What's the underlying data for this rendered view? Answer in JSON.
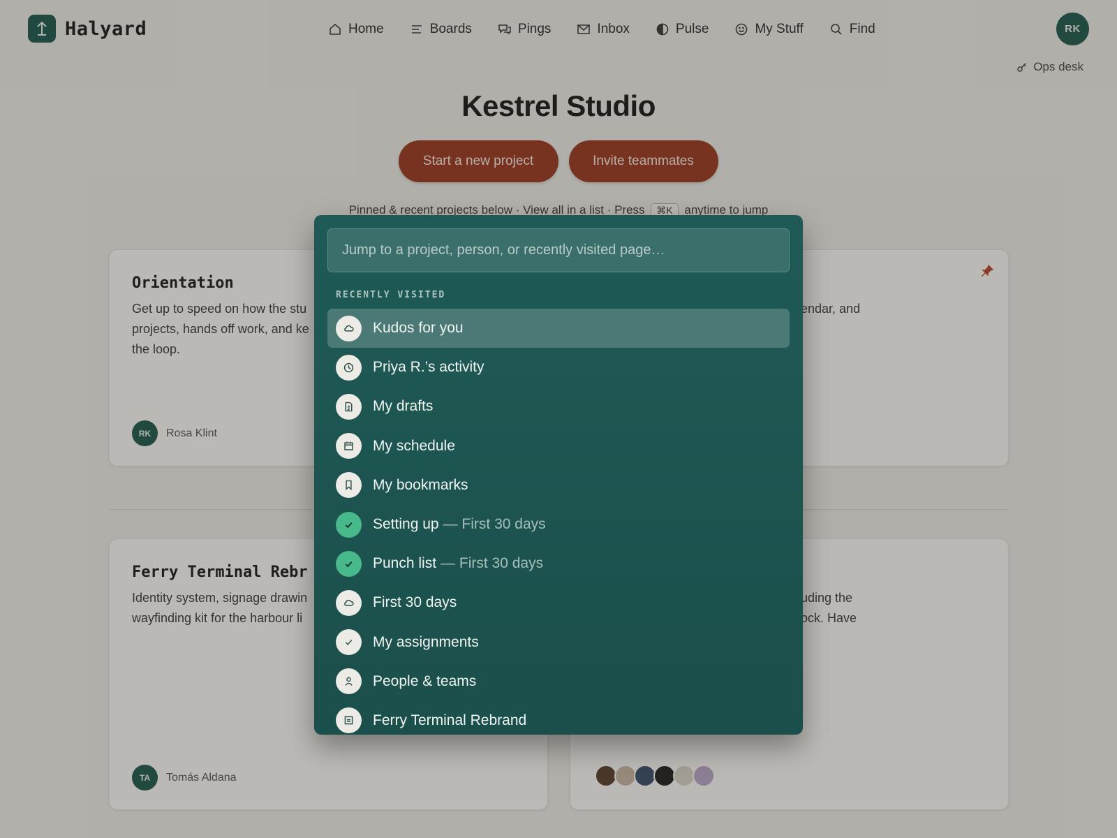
{
  "app": {
    "name": "Halyard"
  },
  "nav": [
    {
      "label": "Home",
      "icon": "home-icon"
    },
    {
      "label": "Boards",
      "icon": "boards-icon"
    },
    {
      "label": "Pings",
      "icon": "chat-icon"
    },
    {
      "label": "Inbox",
      "icon": "mail-icon"
    },
    {
      "label": "Pulse",
      "icon": "half-circle-icon"
    },
    {
      "label": "My Stuff",
      "icon": "smiley-icon"
    },
    {
      "label": "Find",
      "icon": "search-icon"
    }
  ],
  "user": {
    "initials": "RK"
  },
  "ops_desk": {
    "label": "Ops desk"
  },
  "page": {
    "title": "Kestrel Studio",
    "new_project_label": "Start a new project",
    "invite_label": "Invite teammates",
    "hint_pre": "Pinned & recent projects below · View all in a list · Press",
    "hint_key": "⌘K",
    "hint_post": "anytime to jump"
  },
  "cards": [
    {
      "title": "Orientation",
      "desc_lines": [
        "Get up to speed on how the stu",
        "projects, hands off work, and ke",
        "the loop."
      ],
      "owner_initials": "RK",
      "owner_name": "Rosa Klint"
    },
    {
      "desc_line": "endar, and"
    },
    {
      "title": "Ferry Terminal Rebr",
      "desc_lines": [
        "Identity system, signage drawin",
        "wayfinding kit for the harbour li"
      ],
      "owner_initials": "TA",
      "owner_name": "Tomás Aldana"
    },
    {
      "desc_lines": [
        "uding the",
        "ock. Have"
      ]
    }
  ],
  "palette": {
    "placeholder": "Jump to a project, person, or recently visited page…",
    "section_label": "RECENTLY VISITED",
    "items": [
      {
        "label": "Kudos for you",
        "sub": "",
        "icon": "cloud-icon",
        "done": false,
        "active": true
      },
      {
        "label": "Priya R.’s activity",
        "sub": "",
        "icon": "clock-icon",
        "done": false,
        "active": false
      },
      {
        "label": "My drafts",
        "sub": "",
        "icon": "document-icon",
        "done": false,
        "active": false
      },
      {
        "label": "My schedule",
        "sub": "",
        "icon": "calendar-icon",
        "done": false,
        "active": false
      },
      {
        "label": "My bookmarks",
        "sub": "",
        "icon": "bookmark-icon",
        "done": false,
        "active": false
      },
      {
        "label": "Setting up",
        "sub": "— First 30 days",
        "icon": "check-icon",
        "done": true,
        "active": false
      },
      {
        "label": "Punch list",
        "sub": "— First 30 days",
        "icon": "check-icon",
        "done": true,
        "active": false
      },
      {
        "label": "First 30 days",
        "sub": "",
        "icon": "cloud-icon",
        "done": false,
        "active": false
      },
      {
        "label": "My assignments",
        "sub": "",
        "icon": "check-icon",
        "done": false,
        "active": false
      },
      {
        "label": "People & teams",
        "sub": "",
        "icon": "person-icon",
        "done": false,
        "active": false
      },
      {
        "label": "Ferry Terminal Rebrand",
        "sub": "",
        "icon": "project-icon",
        "done": false,
        "active": false
      }
    ]
  },
  "colors": {
    "brand": "#1f5a50",
    "accent": "#9a3a22",
    "palette_bg": "#1f5a57",
    "check": "#47b98a"
  }
}
